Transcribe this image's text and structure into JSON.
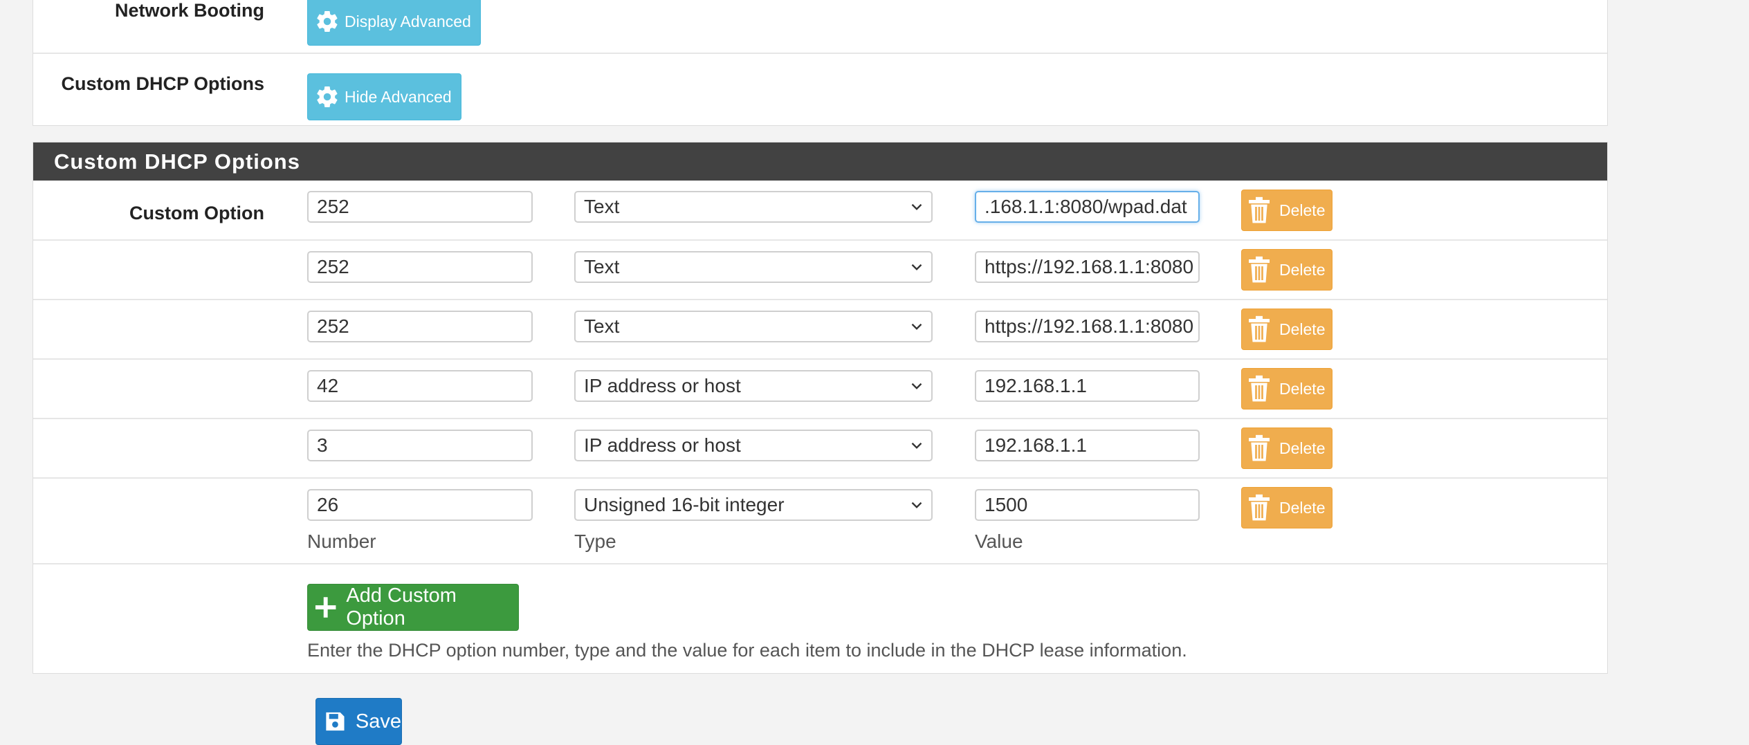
{
  "top_section": {
    "network_booting": {
      "label": "Network Booting",
      "button_label": "Display Advanced"
    },
    "custom_dhcp": {
      "label": "Custom DHCP Options",
      "button_label": "Hide Advanced"
    }
  },
  "panel": {
    "title": "Custom DHCP Options",
    "row_label": "Custom Option",
    "delete_label": "Delete",
    "rows": [
      {
        "number": "252",
        "type": "Text",
        "value": ".168.1.1:8080/wpad.dat"
      },
      {
        "number": "252",
        "type": "Text",
        "value": "https://192.168.1.1:8080"
      },
      {
        "number": "252",
        "type": "Text",
        "value": "https://192.168.1.1:8080"
      },
      {
        "number": "42",
        "type": "IP address or host",
        "value": "192.168.1.1"
      },
      {
        "number": "3",
        "type": "IP address or host",
        "value": "192.168.1.1"
      },
      {
        "number": "26",
        "type": "Unsigned 16-bit integer",
        "value": "1500"
      }
    ],
    "captions": {
      "number": "Number",
      "type": "Type",
      "value": "Value"
    },
    "add_button_label": "Add Custom Option",
    "help_text": "Enter the DHCP option number, type and the value for each item to include in the DHCP lease information."
  },
  "save_label": "Save",
  "colors": {
    "info": "#5bc0de",
    "warning": "#f0ad4e",
    "success": "#3c9a3e",
    "primary": "#1f7bc6",
    "heading": "#424242"
  },
  "icons": [
    "gear-icon",
    "chevron-down-icon",
    "trash-icon",
    "plus-icon",
    "save-icon"
  ]
}
